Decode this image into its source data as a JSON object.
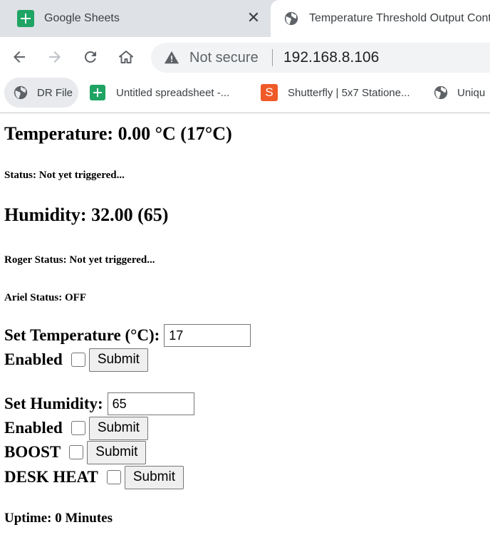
{
  "browser": {
    "tabs": [
      {
        "title": "Google Sheets",
        "icon": "sheets-icon",
        "active": false
      },
      {
        "title": "Temperature Threshold Output Contr",
        "icon": "globe-icon",
        "active": true
      }
    ],
    "close_glyph": "✕",
    "address": {
      "security_label": "Not secure",
      "url": "192.168.8.106"
    },
    "bookmarks": [
      {
        "label": "DR File",
        "icon": "globe-icon"
      },
      {
        "label": "Untitled spreadsheet -...",
        "icon": "sheets-icon"
      },
      {
        "label": "Shutterfly | 5x7 Statione...",
        "icon": "shutterfly-icon",
        "glyph": "S"
      },
      {
        "label": "Uniqu",
        "icon": "globe-icon"
      }
    ]
  },
  "page": {
    "temperature_heading": "Temperature: 0.00 °C (17°C)",
    "status": "Status: Not yet triggered...",
    "humidity_heading": "Humidity: 32.00 (65)",
    "roger_status": "Roger Status: Not yet triggered...",
    "ariel_status": "Ariel Status: OFF",
    "set_temperature": {
      "label": "Set Temperature (°C):",
      "value": "17"
    },
    "temp_enabled": {
      "label": "Enabled",
      "checked": false,
      "button": "Submit"
    },
    "set_humidity": {
      "label": "Set Humidity:",
      "value": "65"
    },
    "hum_enabled": {
      "label": "Enabled",
      "checked": false,
      "button": "Submit"
    },
    "boost": {
      "label": "BOOST",
      "checked": false,
      "button": "Submit"
    },
    "desk_heat": {
      "label": "DESK HEAT",
      "checked": false,
      "button": "Submit"
    },
    "uptime": "Uptime: 0 Minutes"
  },
  "colors": {
    "tab_strip": "#dee1e6",
    "sheets_green": "#1fa463",
    "shutterfly_orange": "#f05a28",
    "omnibox": "#f1f3f4"
  }
}
